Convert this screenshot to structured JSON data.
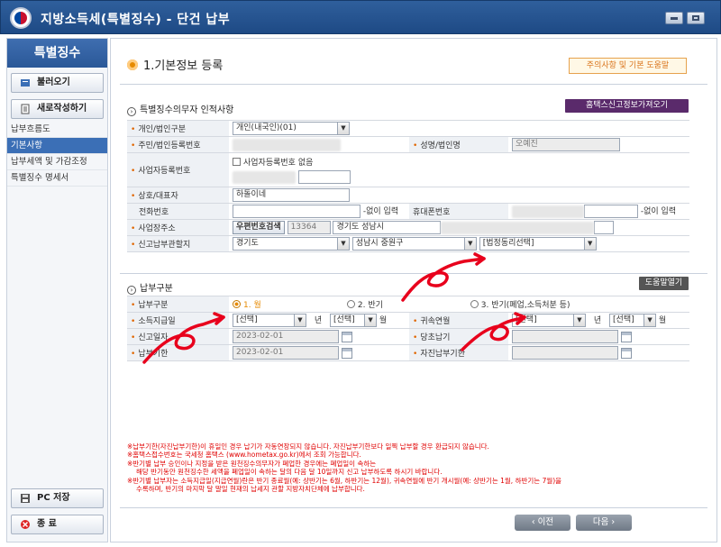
{
  "window": {
    "title": "지방소득세(특별징수) - 단건 납부"
  },
  "sidebar": {
    "header": "특별징수",
    "load_button": "불러오기",
    "new_button": "새로작성하기",
    "items": [
      {
        "label": "납부흐름도",
        "active": false
      },
      {
        "label": "기본사항",
        "active": true
      },
      {
        "label": "납부세액 및 가감조정",
        "active": false
      },
      {
        "label": "특별징수 명세서",
        "active": false
      }
    ],
    "save_button": "PC 저장",
    "exit_button": "종 료"
  },
  "page": {
    "title": "1.기본정보 등록",
    "help_button": "주의사항 및 기본 도움말"
  },
  "section1": {
    "title": "특별징수의무자 인적사항",
    "hometax_button": "홈택스신고정보가져오기",
    "labels": {
      "person_type": "개인/법인구분",
      "resident_no": "주민/법인등록번호",
      "name": "성명/법인명",
      "biz_no": "사업자등록번호",
      "biz_none": "사업자등록번호 없음",
      "company": "상호/대표자",
      "phone": "전화번호",
      "no_dash1": "-없이 입력",
      "mobile": "휴대폰번호",
      "no_dash2": "-없이 입력",
      "address": "사업장주소",
      "zip_button": "우편번호검색",
      "office": "신고납부관할지"
    },
    "values": {
      "person_type": "개인(내국인)(01)",
      "name": "오예진",
      "company": "하돌이네",
      "zip": "13364",
      "address1": "경기도 성남시",
      "province": "경기도",
      "city": "성남시 중원구",
      "dong": "[법정동리선택]"
    }
  },
  "section2": {
    "title": "납부구분",
    "help_button": "도움말열기",
    "labels": {
      "pay_type": "납부구분",
      "income_month": "소득지급일",
      "year_unit": "년",
      "month_unit": "월",
      "attr_month": "귀속연월",
      "report_date": "신고일자",
      "original_due": "당초납기",
      "due_date": "납부기한",
      "self_due": "자진납부기한"
    },
    "radios": [
      "1. 월",
      "2. 반기",
      "3. 반기(폐업,소득처분 등)"
    ],
    "values": {
      "select_placeholder": "[선택]",
      "report_date": "2023-02-01",
      "due_date": "2023-02-01"
    }
  },
  "notes": [
    "※납부기한(자진납부기한)이 휴일인 경우 납기가 자동연장되지 않습니다. 자진납부기한보다 일찍 납부할 경우 환급되지 않습니다.",
    "※홈택스접수번호는 국세청 홈택스 (www.hometax.go.kr)에서 조회 가능합니다.",
    "※반기별 납부 승인이나 지정을 받은 원천징수의무자가 폐업한 경우에는 폐업일이 속하는",
    "해당 반기동안 원천징수한 세액을 폐업일이 속하는 달의 다음 달 10일까지 신고 납부하도록 하시기 바랍니다.",
    "※반기별 납부자는 소득지급일(지급연월)란은 반기 종료월(예: 상반기는 6월, 하반기는 12월), 귀속연월에 반기 개시월(예: 상반기는 1월, 하반기는 7월)을",
    "수록하며, 반기의 마지막 달 말일 현재의 납세지 관할 지방자치단체에 납부합니다."
  ],
  "footer": {
    "prev_button": "이전",
    "next_button": "다음"
  },
  "colors": {
    "accent_orange": "#e68a00",
    "brand_blue": "#2a5898",
    "hometax_purple": "#5a2a6b",
    "annotation_red": "#e8001c",
    "notes_red": "#e00000"
  }
}
